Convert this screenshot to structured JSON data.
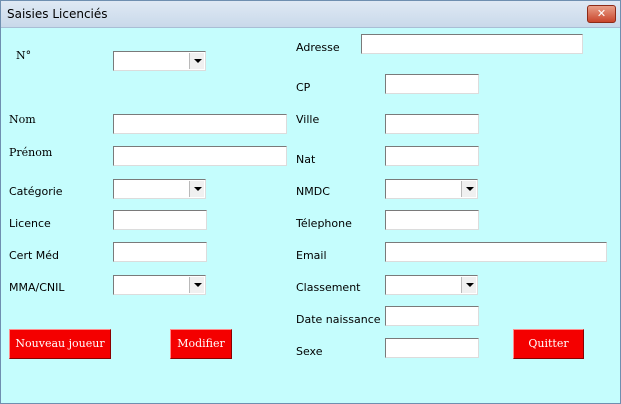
{
  "window": {
    "title": "Saisies Licenciés",
    "close_label": "✕"
  },
  "form": {
    "numero_label": "N°",
    "nom_label": "Nom",
    "prenom_label": "Prénom",
    "categorie_label": "Catégorie",
    "licence_label": "Licence",
    "certmed_label": "Cert Méd",
    "mma_label": "MMA/CNIL",
    "adresse_label": "Adresse",
    "cp_label": "CP",
    "ville_label": "Ville",
    "nat_label": "Nat",
    "nmdc_label": "NMDC",
    "telephone_label": "Télephone",
    "email_label": "Email",
    "classement_label": "Classement",
    "date_naissance_label": "Date naissance",
    "sexe_label": "Sexe"
  },
  "buttons": {
    "nouveau_joueur": "Nouveau joueur",
    "modifier": "Modifier",
    "quitter": "Quitter"
  },
  "icons": {
    "close": "close-icon",
    "dropdown": "chevron-down-icon"
  },
  "colors": {
    "form_background": "#c5fdfd",
    "button_red": "#f40000",
    "close_button": "#c9452b"
  }
}
